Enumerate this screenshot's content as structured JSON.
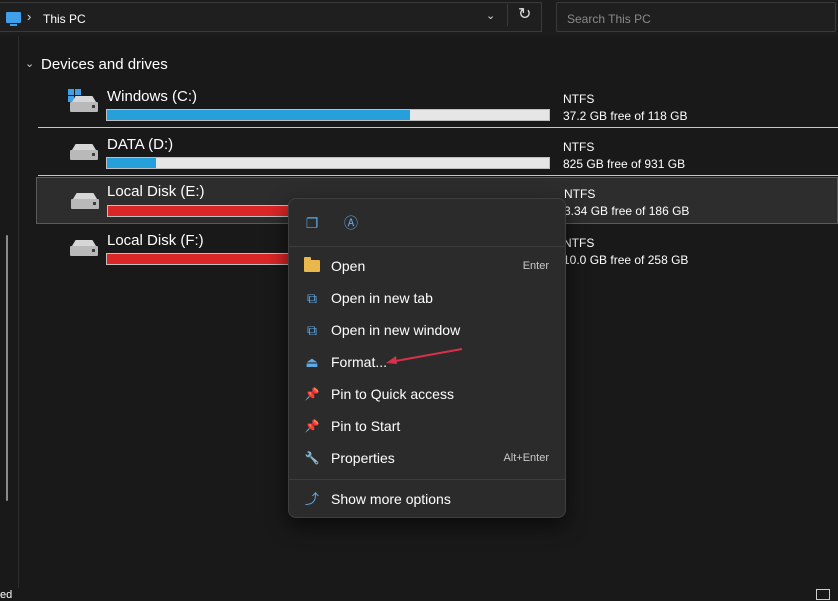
{
  "address_bar": {
    "breadcrumb_sep": "›",
    "location": "This PC",
    "dropdown_glyph": "⌄",
    "refresh_glyph": "↻"
  },
  "search": {
    "placeholder": "Search This PC",
    "value": ""
  },
  "group": {
    "title": "Devices and drives",
    "chevron": "⌄"
  },
  "drives": [
    {
      "name": "Windows (C:)",
      "filesystem": "NTFS",
      "free_text": "37.2 GB free of 118 GB",
      "used_fraction": 0.685,
      "bar_color": "#26a0da",
      "system_drive": true
    },
    {
      "name": "DATA (D:)",
      "filesystem": "NTFS",
      "free_text": "825 GB free of 931 GB",
      "used_fraction": 0.11,
      "bar_color": "#26a0da"
    },
    {
      "name": "Local Disk (E:)",
      "filesystem": "NTFS",
      "free_text": "3.34 GB free of 186 GB",
      "used_fraction": 0.98,
      "bar_color": "#da2626",
      "selected": true
    },
    {
      "name": "Local Disk (F:)",
      "filesystem": "NTFS",
      "free_text": "10.0 GB free of 258 GB",
      "used_fraction": 0.96,
      "bar_color": "#da2626"
    }
  ],
  "context_menu": {
    "top_actions": [
      {
        "icon": "copy-icon",
        "glyph": "❐"
      },
      {
        "icon": "rename-icon",
        "glyph": "Ⓐ"
      }
    ],
    "items": [
      {
        "label": "Open",
        "shortcut": "Enter",
        "icon": "folder-open-icon",
        "glyph": ""
      },
      {
        "label": "Open in new tab",
        "shortcut": "",
        "icon": "new-tab-icon",
        "glyph": "⧉"
      },
      {
        "label": "Open in new window",
        "shortcut": "",
        "icon": "new-window-icon",
        "glyph": "⧉"
      },
      {
        "label": "Format...",
        "shortcut": "",
        "icon": "format-icon",
        "glyph": "⏏"
      },
      {
        "label": "Pin to Quick access",
        "shortcut": "",
        "icon": "pin-icon",
        "glyph": "📌"
      },
      {
        "label": "Pin to Start",
        "shortcut": "",
        "icon": "pin-start-icon",
        "glyph": "📌"
      },
      {
        "label": "Properties",
        "shortcut": "Alt+Enter",
        "icon": "wrench-icon",
        "glyph": "🔧"
      }
    ],
    "more": {
      "label": "Show more options",
      "icon": "more-options-icon",
      "glyph": "⤴"
    }
  },
  "status": {
    "text": "ed"
  },
  "colors": {
    "accent": "#26a0da",
    "warning_bar": "#da2626",
    "annotation_arrow": "#d8304a"
  }
}
